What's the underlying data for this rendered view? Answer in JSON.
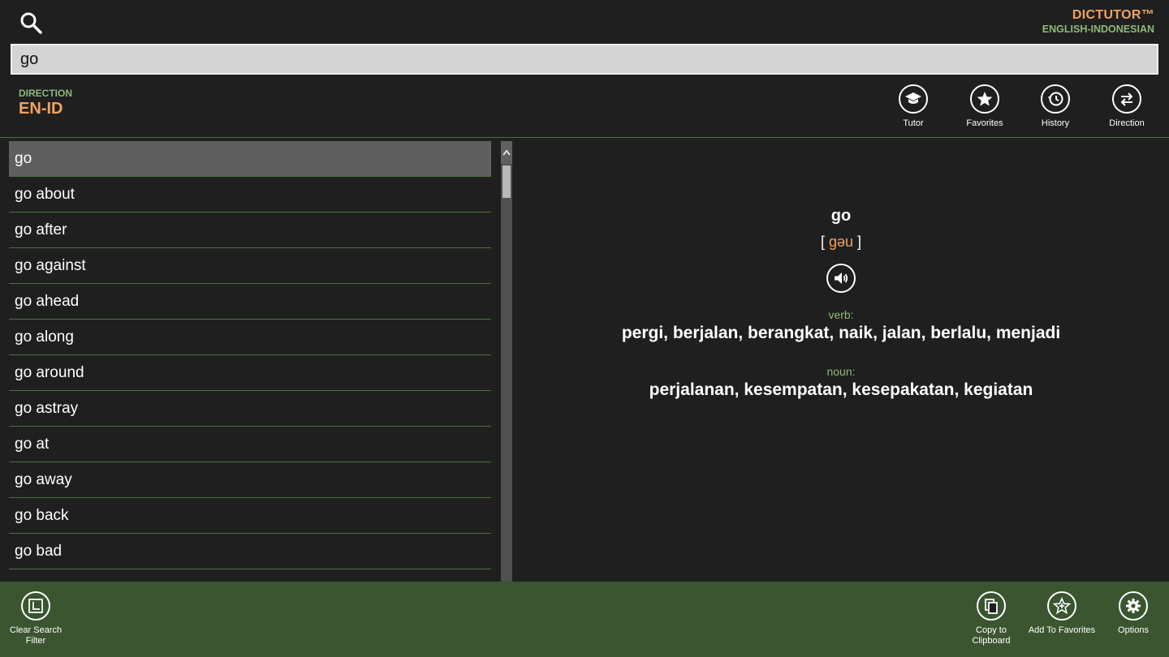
{
  "brand": {
    "name": "DICTUTOR™",
    "subtitle": "ENGLISH-INDONESIAN"
  },
  "search": {
    "value": "go",
    "placeholder": ""
  },
  "direction": {
    "label": "DIRECTION",
    "value": "EN-ID"
  },
  "toolbar": {
    "tutor": "Tutor",
    "favorites": "Favorites",
    "history": "History",
    "direction": "Direction"
  },
  "word_list": [
    "go",
    "go about",
    "go after",
    "go against",
    "go ahead",
    "go along",
    "go around",
    "go astray",
    "go at",
    "go away",
    "go back",
    "go bad"
  ],
  "detail": {
    "word": "go",
    "bracket_open": "[",
    "pronunciation": "gəu",
    "bracket_close": "]",
    "entries": [
      {
        "pos": "verb:",
        "translation": "pergi, berjalan, berangkat, naik, jalan, berlalu, menjadi"
      },
      {
        "pos": "noun:",
        "translation": "perjalanan, kesempatan, kesepakatan, kegiatan"
      }
    ]
  },
  "bottom_bar": {
    "clear_filter_line1": "Clear Search",
    "clear_filter_line2": "Filter",
    "copy_line1": "Copy to",
    "copy_line2": "Clipboard",
    "add_favorites": "Add To Favorites",
    "options": "Options"
  },
  "colors": {
    "background": "#1f1f1f",
    "accent_orange": "#f2a35e",
    "accent_green": "#8fb87a",
    "bottom_bar": "#3a5530",
    "selected_row": "#5f5f5f"
  }
}
